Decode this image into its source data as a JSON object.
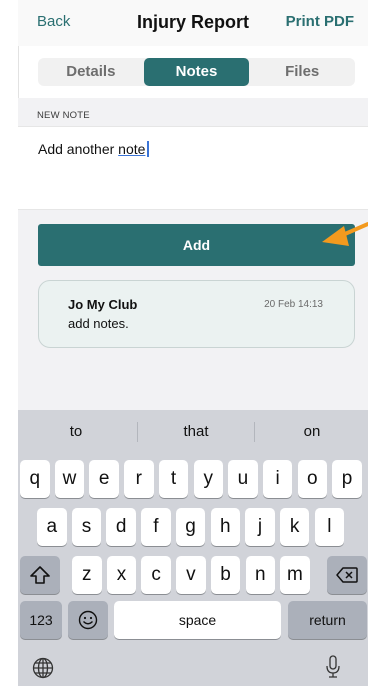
{
  "nav": {
    "back": "Back",
    "title": "Injury Report",
    "print": "Print PDF"
  },
  "tabs": [
    {
      "label": "Details",
      "active": false
    },
    {
      "label": "Notes",
      "active": true
    },
    {
      "label": "Files",
      "active": false
    }
  ],
  "new_note": {
    "section_label": "NEW NOTE",
    "text_before": "Add another ",
    "text_underlined": "note"
  },
  "add_button": "Add",
  "notes": [
    {
      "author": "Jo My Club",
      "time": "20 Feb 14:13",
      "body": "add notes."
    }
  ],
  "keyboard": {
    "suggestions": [
      "to",
      "that",
      "on"
    ],
    "row1": [
      "q",
      "w",
      "e",
      "r",
      "t",
      "y",
      "u",
      "i",
      "o",
      "p"
    ],
    "row2": [
      "a",
      "s",
      "d",
      "f",
      "g",
      "h",
      "j",
      "k",
      "l"
    ],
    "row3": [
      "z",
      "x",
      "c",
      "v",
      "b",
      "n",
      "m"
    ],
    "numbers_key": "123",
    "space_key": "space",
    "return_key": "return"
  },
  "colors": {
    "accent": "#2a6f71",
    "arrow": "#f39a1e",
    "card": "#ebf2f1",
    "keyboard_bg": "#d1d3d9"
  }
}
